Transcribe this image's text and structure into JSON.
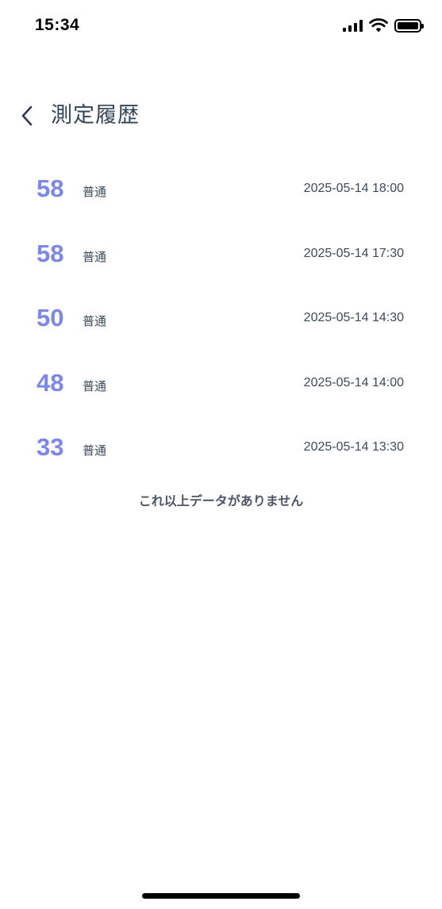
{
  "status_bar": {
    "time": "15:34",
    "icons": [
      "signal-icon",
      "wifi-icon",
      "battery-icon"
    ]
  },
  "header": {
    "back_icon": "chevron-left-icon",
    "title": "測定履歴"
  },
  "history": [
    {
      "score": "58",
      "level": "普通",
      "datetime": "2025-05-14 18:00"
    },
    {
      "score": "58",
      "level": "普通",
      "datetime": "2025-05-14 17:30"
    },
    {
      "score": "50",
      "level": "普通",
      "datetime": "2025-05-14 14:30"
    },
    {
      "score": "48",
      "level": "普通",
      "datetime": "2025-05-14 14:00"
    },
    {
      "score": "33",
      "level": "普通",
      "datetime": "2025-05-14 13:30"
    }
  ],
  "end_message": "これ以上データがありません",
  "colors": {
    "score": "#7b86ee",
    "text": "#3c4a5c",
    "title": "#34445a",
    "background": "#ffffff"
  }
}
